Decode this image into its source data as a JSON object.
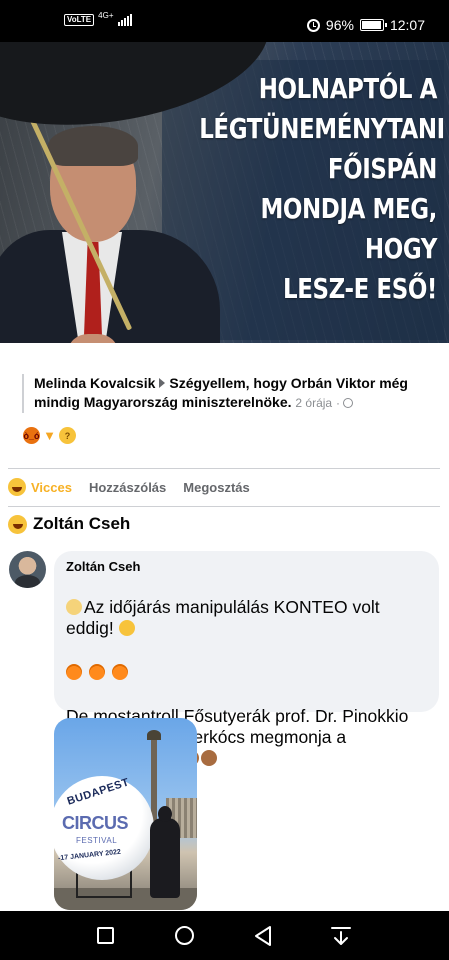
{
  "status_bar": {
    "volte": "VoLTE",
    "network": "4G+",
    "battery_percent": "96%",
    "battery_level": 0.96,
    "time": "12:07"
  },
  "meme": {
    "text": "HOLNAPTÓL A\nLÉGTÜNEMÉNYTANI\nFŐISPÁN\nMONDJA MEG, HOGY\nLESZ-E ESŐ!"
  },
  "shared_post": {
    "author": "Melinda Kovalcsik",
    "group": "Szégyellem, hogy Orbán Viktor még mindig Magyarország miniszterelnöke.",
    "time": "2 órája",
    "separator": "·",
    "reactions": [
      "angry",
      "thumbs-down",
      "thinking"
    ]
  },
  "actions": {
    "reaction_label": "Vicces",
    "comment_label": "Hozzászólás",
    "share_label": "Megosztás"
  },
  "reactor": {
    "name": "Zoltán Cseh"
  },
  "comment": {
    "author": "Zoltán Cseh",
    "line1": "Az időjárás manipulálás KONTEO volt eddig!",
    "line2": "De mostantroll Fősutyerák prof. Dr. Pinokkio PhD időjós mesterkócs megmonja a hogyityeget!",
    "photo": {
      "text_top": "BUDAPEST",
      "text_main": "CIRCUS",
      "text_sub": "FESTIVAL",
      "text_date": "-17 JANUARY 2022"
    }
  },
  "colors": {
    "accent_haha": "#f7b125",
    "text_secondary": "#65676b",
    "bubble": "#f0f2f5"
  }
}
